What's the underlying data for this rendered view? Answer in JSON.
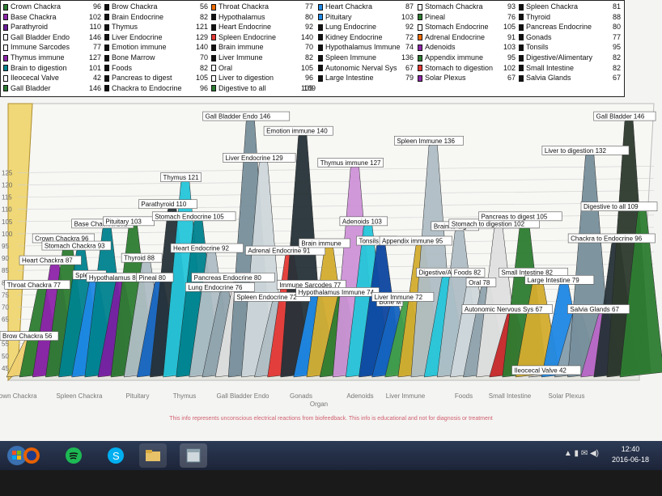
{
  "legend": [
    {
      "col": 0,
      "row": 0,
      "label": "Crown Chackra",
      "value": 96,
      "color": "#2e7d32"
    },
    {
      "col": 0,
      "row": 1,
      "label": "Base Chackra",
      "value": 102,
      "color": "#8e24aa"
    },
    {
      "col": 0,
      "row": 2,
      "label": "Parathyroid",
      "value": 110,
      "color": "#6a1b9a"
    },
    {
      "col": 0,
      "row": 3,
      "label": "Gall Bladder  Endo",
      "value": 146,
      "color": "#ffffff"
    },
    {
      "col": 0,
      "row": 4,
      "label": "Immune Sarcodes",
      "value": 77,
      "color": "#ffffff"
    },
    {
      "col": 0,
      "row": 5,
      "label": "Thymus immune",
      "value": 127,
      "color": "#8e24aa"
    },
    {
      "col": 0,
      "row": 6,
      "label": "Brain to digestion",
      "value": 101,
      "color": "#00838f"
    },
    {
      "col": 0,
      "row": 7,
      "label": "Ileocecal Valve",
      "value": 42,
      "color": "#ffffff"
    },
    {
      "col": 0,
      "row": 8,
      "label": "Gall Bladder",
      "value": 146,
      "color": "#2e7d32"
    },
    {
      "col": 1,
      "row": 0,
      "label": "Brow Chackra",
      "value": 56,
      "color": "#111111"
    },
    {
      "col": 1,
      "row": 1,
      "label": "Brain  Endocrine",
      "value": 82,
      "color": "#111111"
    },
    {
      "col": 1,
      "row": 2,
      "label": "Thymus",
      "value": 121,
      "color": "#111111"
    },
    {
      "col": 1,
      "row": 3,
      "label": "Liver Endocrine",
      "value": 129,
      "color": "#111111"
    },
    {
      "col": 1,
      "row": 4,
      "label": "Emotion immune",
      "value": 140,
      "color": "#111111"
    },
    {
      "col": 1,
      "row": 5,
      "label": "Bone Marrow",
      "value": 70,
      "color": "#111111"
    },
    {
      "col": 1,
      "row": 6,
      "label": "Foods",
      "value": 82,
      "color": "#111111"
    },
    {
      "col": 1,
      "row": 7,
      "label": "Pancreas to digest",
      "value": 105,
      "color": "#111111"
    },
    {
      "col": 1,
      "row": 8,
      "label": "Chackra to Endocrine",
      "value": 96,
      "color": "#111111"
    },
    {
      "col": 2,
      "row": 0,
      "label": "Throat Chackra",
      "value": 77,
      "color": "#ef6c00"
    },
    {
      "col": 2,
      "row": 1,
      "label": "Hypothalamus",
      "value": 80,
      "color": "#111111"
    },
    {
      "col": 2,
      "row": 2,
      "label": "Heart Endocrine",
      "value": 92,
      "color": "#111111"
    },
    {
      "col": 2,
      "row": 3,
      "label": "Spleen Endocrine",
      "value": 140,
      "color": "#e53935"
    },
    {
      "col": 2,
      "row": 4,
      "label": "Brain  immune",
      "value": 70,
      "color": "#111111"
    },
    {
      "col": 2,
      "row": 5,
      "label": "Liver Immune",
      "value": 82,
      "color": "#111111"
    },
    {
      "col": 2,
      "row": 6,
      "label": "Oral",
      "value": 105,
      "color": "#ffffff"
    },
    {
      "col": 2,
      "row": 7,
      "label": "Liver to digestion",
      "value": 96,
      "color": "#ffffff"
    },
    {
      "col": 2,
      "row": 8,
      "label": "Digestive to all",
      "value": 109,
      "color": "#2e7d32"
    },
    {
      "col": 3,
      "row": 0,
      "label": "Heart Chackra",
      "value": 87,
      "color": "#1e88e5"
    },
    {
      "col": 3,
      "row": 1,
      "label": "Pituitary",
      "value": 103,
      "color": "#1e88e5"
    },
    {
      "col": 3,
      "row": 2,
      "label": "Lung Endocrine",
      "value": 92,
      "color": "#111111"
    },
    {
      "col": 3,
      "row": 3,
      "label": "Kidney  Endocrine",
      "value": 72,
      "color": "#111111"
    },
    {
      "col": 3,
      "row": 4,
      "label": "Hypothalamus Immune",
      "value": 74,
      "color": "#111111"
    },
    {
      "col": 3,
      "row": 5,
      "label": "Spleen  Immune",
      "value": 136,
      "color": "#111111"
    },
    {
      "col": 3,
      "row": 6,
      "label": "Autonomic Nerval Sys",
      "value": 67,
      "color": "#111111"
    },
    {
      "col": 3,
      "row": 7,
      "label": "Large Intestine",
      "value": 79,
      "color": "#111111"
    },
    {
      "col": 4,
      "row": 0,
      "label": "Stomach Chackra",
      "value": 93,
      "color": "#ffffff"
    },
    {
      "col": 4,
      "row": 1,
      "label": "Pineal",
      "value": 76,
      "color": "#2e7d32"
    },
    {
      "col": 4,
      "row": 2,
      "label": "Stomach  Endocrine",
      "value": 105,
      "color": "#ffffff"
    },
    {
      "col": 4,
      "row": 3,
      "label": "Adrenal  Endocrine",
      "value": 91,
      "color": "#ef6c00"
    },
    {
      "col": 4,
      "row": 4,
      "label": "Adenoids",
      "value": 103,
      "color": "#8e24aa"
    },
    {
      "col": 4,
      "row": 5,
      "label": "Appendix  immune",
      "value": 95,
      "color": "#2e7d32"
    },
    {
      "col": 4,
      "row": 6,
      "label": "Stomach to digestion",
      "value": 102,
      "color": "#e53935"
    },
    {
      "col": 4,
      "row": 7,
      "label": "Solar Plexus",
      "value": 67,
      "color": "#8e24aa"
    },
    {
      "col": 5,
      "row": 0,
      "label": "Spleen Chackra",
      "value": 81,
      "color": "#111111"
    },
    {
      "col": 5,
      "row": 1,
      "label": "Thyroid",
      "value": 88,
      "color": "#111111"
    },
    {
      "col": 5,
      "row": 2,
      "label": "Pancreas  Endocrine",
      "value": 80,
      "color": "#111111"
    },
    {
      "col": 5,
      "row": 3,
      "label": "Gonads",
      "value": 77,
      "color": "#111111"
    },
    {
      "col": 5,
      "row": 4,
      "label": "Tonsils",
      "value": 95,
      "color": "#111111"
    },
    {
      "col": 5,
      "row": 5,
      "label": "Digestive/Alimentary",
      "value": 82,
      "color": "#111111"
    },
    {
      "col": 5,
      "row": 6,
      "label": "Small Intestine",
      "value": 82,
      "color": "#111111"
    },
    {
      "col": 5,
      "row": 7,
      "label": "Salvia Glands",
      "value": 67,
      "color": "#111111"
    }
  ],
  "legend_extra_value": 109,
  "chart_data": {
    "type": "area",
    "title": "",
    "xlabel": "",
    "ylabel": "",
    "y_ticks": [
      45,
      50,
      55,
      65,
      70,
      75,
      80,
      85,
      90,
      95,
      100,
      105,
      110,
      115,
      120,
      125
    ],
    "ylim": [
      40,
      150
    ],
    "x_tick_labels": [
      "Crown Chackra",
      "Spleen Chackra",
      "Pituitary",
      "Thymus",
      "Gall Bladder  Endo",
      "Gonads",
      "Organ",
      "Adenoids",
      "Liver  Immune",
      "Foods",
      "Small Intestine",
      "Solar Plexus"
    ],
    "series_colors": [
      "#2e7d32",
      "#1565c0",
      "#00838f",
      "#7b1fa2",
      "#e53935",
      "#90a4ae",
      "#d4ad2f",
      "#0d47a1",
      "#43a047",
      "#ba68c8",
      "#b0bec5",
      "#263238",
      "#26c6da",
      "#37474f",
      "#c62828"
    ],
    "peaks": [
      {
        "label": "Brow Chackra 56",
        "value": 56,
        "color": "#f0d070"
      },
      {
        "label": "Throat Chackra 77",
        "value": 77,
        "color": "#2e7d32"
      },
      {
        "label": "Heart Chackra 87",
        "value": 87,
        "color": "#8e24aa"
      },
      {
        "label": "Crown Chackra 96",
        "value": 96,
        "color": "#2e7d32"
      },
      {
        "label": "Stomach Chackra 93",
        "value": 93,
        "color": "#00838f"
      },
      {
        "label": "Spleen C",
        "value": 81,
        "color": "#1e88e5"
      },
      {
        "label": "Base Chackra 102",
        "value": 102,
        "color": "#00838f"
      },
      {
        "label": "Hypothalamus 80",
        "value": 80,
        "color": "#7b1fa2"
      },
      {
        "label": "Pituitary 103",
        "value": 103,
        "color": "#2e7d32"
      },
      {
        "label": "Thyroid 88",
        "value": 88,
        "color": "#b0bec5"
      },
      {
        "label": "Pineal 80",
        "value": 80,
        "color": "#1565c0"
      },
      {
        "label": "Parathyroid 110",
        "value": 110,
        "color": "#263238"
      },
      {
        "label": "Thymus 121",
        "value": 121,
        "color": "#26c6da"
      },
      {
        "label": "Stomach  Endocrine 105",
        "value": 105,
        "color": "#00838f"
      },
      {
        "label": "Heart  Endocrine 92",
        "value": 92,
        "color": "#b0bec5"
      },
      {
        "label": "Lung  Endocrine 76",
        "value": 76,
        "color": "#90a4ae"
      },
      {
        "label": "Pancreas  Endocrine 80",
        "value": 80,
        "color": "#e0e0e0"
      },
      {
        "label": "Gall Bladder   Endo 146",
        "value": 146,
        "color": "#78909c"
      },
      {
        "label": "Liver Endocrine 129",
        "value": 129,
        "color": "#cfd8dc"
      },
      {
        "label": "Spleen  Endocrine 72",
        "value": 72,
        "color": "#b0bec5"
      },
      {
        "label": "Adrenal  Endocrine 91",
        "value": 91,
        "color": "#e53935"
      },
      {
        "label": "Emotion immune 140",
        "value": 140,
        "color": "#263238"
      },
      {
        "label": "Immune Sarcodes 77",
        "value": 77,
        "color": "#1e88e5"
      },
      {
        "label": "Brain  immune",
        "value": 94,
        "color": "#d4ad2f"
      },
      {
        "label": "Hypothalamus Immune 74",
        "value": 74,
        "color": "#2e7d32"
      },
      {
        "label": "Thymus immune 127",
        "value": 127,
        "color": "#ce93d8"
      },
      {
        "label": "Adenoids 103",
        "value": 103,
        "color": "#26c6da"
      },
      {
        "label": "Tonsils 95",
        "value": 95,
        "color": "#0d47a1"
      },
      {
        "label": "Bone M",
        "value": 70,
        "color": "#1565c0"
      },
      {
        "label": "Liver  Immune 72",
        "value": 72,
        "color": "#43a047"
      },
      {
        "label": "Appendix  immune 95",
        "value": 95,
        "color": "#d4ad2f"
      },
      {
        "label": "Spleen  Immune 136",
        "value": 136,
        "color": "#b0bec5"
      },
      {
        "label": "Digestive/Ali",
        "value": 82,
        "color": "#26c6da"
      },
      {
        "label": "Brain to dig",
        "value": 101,
        "color": "#b0bec5"
      },
      {
        "label": "Foods 82",
        "value": 82,
        "color": "#cfd8dc"
      },
      {
        "label": "Oral 78",
        "value": 78,
        "color": "#90a4ae"
      },
      {
        "label": "Stomach to digestion 102",
        "value": 102,
        "color": "#e0e0e0"
      },
      {
        "label": "Autonomic Nervous Sys 67",
        "value": 67,
        "color": "#c62828"
      },
      {
        "label": "Pancreas to digest 105",
        "value": 105,
        "color": "#2e7d32"
      },
      {
        "label": "Small Intestine 82",
        "value": 82,
        "color": "#d4ad2f"
      },
      {
        "label": "Ileocecal Valve 42",
        "value": 42,
        "color": "#1565c0"
      },
      {
        "label": "Large Intestine 79",
        "value": 79,
        "color": "#1e88e5"
      },
      {
        "label": "S",
        "value": 67,
        "color": "#90a4ae"
      },
      {
        "label": "Liver  to digestion 132",
        "value": 132,
        "color": "#78909c"
      },
      {
        "label": "Salvia Glands 67",
        "value": 67,
        "color": "#ba68c8"
      },
      {
        "label": "Chackra to Endocrine 96",
        "value": 96,
        "color": "#263238"
      },
      {
        "label": "Gall Bladder 146",
        "value": 146,
        "color": "#2e3a2e"
      },
      {
        "label": "Digestive to all 109",
        "value": 109,
        "color": "#2e7d32"
      }
    ]
  },
  "disclaimer": "This info represents unconscious electrical reactions from biofeedback. This info is educational and  not  for diagnosis or treatment",
  "taskbar": {
    "time": "12:40",
    "date": "2016-06-18",
    "apps": [
      "firefox-icon",
      "spotify-icon",
      "skype-icon",
      "folder-icon",
      "window-icon"
    ]
  }
}
